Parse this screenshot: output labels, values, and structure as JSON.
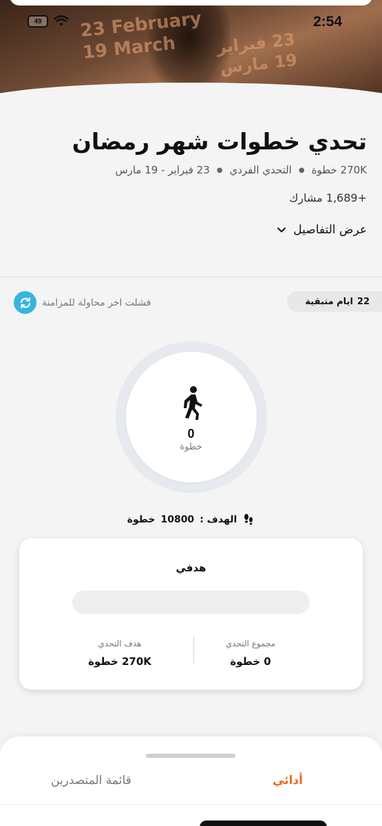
{
  "status_bar": {
    "time": "2:54",
    "battery": "49"
  },
  "hero": {
    "dates_en_1": "23 February",
    "dates_en_2": "19 March",
    "dates_ar_1": "23 فبراير",
    "dates_ar_2": "19 مارس"
  },
  "challenge": {
    "title": "تحدي خطوات شهر رمضان",
    "meta": {
      "target": "270K خطوة",
      "type": "التحدي الفردي",
      "dates": "23 فبراير - 19 مارس"
    },
    "participants": "+1,689 مشارك",
    "details_label": "عرض التفاصيل"
  },
  "status_row": {
    "days_count": "22",
    "days_label": "ايام متبقية",
    "sync_message": "فشلت اخر محاولة للمزامنة"
  },
  "progress_ring": {
    "steps": "0",
    "unit": "خطوة"
  },
  "goal": {
    "label": "الهدف :",
    "value": "10800",
    "unit": "خطوة"
  },
  "my_goal_card": {
    "title": "هدفي",
    "progress": 0,
    "total_label": "مجموع التحدي",
    "total_value": "0 خطوة",
    "target_label": "هدف التحدي",
    "target_value": "270K خطوة"
  },
  "tabs": {
    "mine": "أدائي",
    "leaderboard": "قائمة المتصدرين"
  },
  "colors": {
    "accent": "#f26a22",
    "sync": "#35b5e0",
    "ring": "#e6e9ed"
  }
}
